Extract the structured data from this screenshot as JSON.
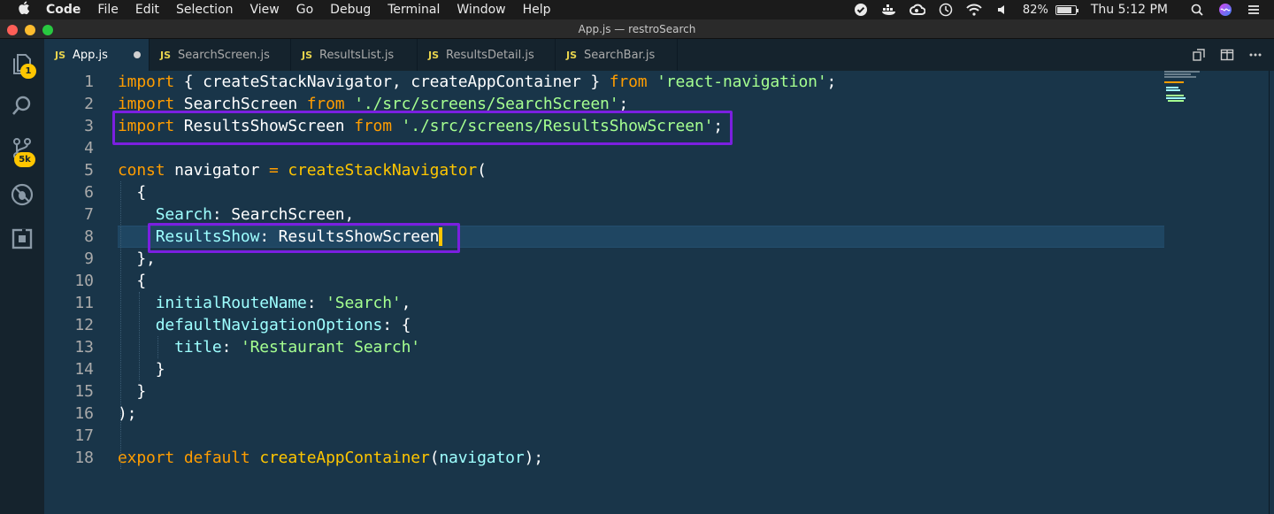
{
  "menubar": {
    "app_name": "Code",
    "items": [
      "File",
      "Edit",
      "Selection",
      "View",
      "Go",
      "Debug",
      "Terminal",
      "Window",
      "Help"
    ],
    "battery_percent": "82%",
    "battery_level": 0.82,
    "clock": "Thu 5:12 PM",
    "status_icons": [
      "checkbox-icon",
      "docker-icon",
      "creative-cloud-icon",
      "time-machine-icon",
      "wifi-icon",
      "volume-icon",
      "spotlight-search-icon",
      "siri-icon",
      "control-center-icon"
    ]
  },
  "window": {
    "title": "App.js — restroSearch"
  },
  "activity_bar": {
    "items": [
      "explorer-icon",
      "search-icon",
      "source-control-icon",
      "debug-icon",
      "extensions-icon"
    ],
    "explorer_badge": "1",
    "source_control_badge": "5k"
  },
  "tabs": [
    {
      "label": "App.js",
      "badge": "JS",
      "active": true,
      "modified": true
    },
    {
      "label": "SearchScreen.js",
      "badge": "JS",
      "active": false
    },
    {
      "label": "ResultsList.js",
      "badge": "JS",
      "active": false
    },
    {
      "label": "ResultsDetail.js",
      "badge": "JS",
      "active": false
    },
    {
      "label": "SearchBar.js",
      "badge": "JS",
      "active": false
    }
  ],
  "editor_actions": [
    "open-changes-icon",
    "split-editor-icon",
    "more-actions-icon"
  ],
  "colors": {
    "background": "#193549",
    "keyword": "#ff9d00",
    "function": "#ffc600",
    "string": "#a5ff90",
    "property": "#9effff",
    "highlight_box": "#7b1fe0",
    "badge": "#ffc600"
  },
  "code": {
    "line_numbers": [
      "1",
      "2",
      "3",
      "4",
      "5",
      "6",
      "7",
      "8",
      "9",
      "10",
      "11",
      "12",
      "13",
      "14",
      "15",
      "16",
      "17",
      "18"
    ],
    "lines": [
      [
        {
          "t": "import",
          "c": "kw"
        },
        {
          "t": " { createStackNavigator, createAppContainer } ",
          "c": "pl"
        },
        {
          "t": "from",
          "c": "kw"
        },
        {
          "t": " ",
          "c": "pl"
        },
        {
          "t": "'react-navigation'",
          "c": "str"
        },
        {
          "t": ";",
          "c": "pl"
        }
      ],
      [
        {
          "t": "import",
          "c": "kw"
        },
        {
          "t": " SearchScreen ",
          "c": "pl"
        },
        {
          "t": "from",
          "c": "kw"
        },
        {
          "t": " ",
          "c": "pl"
        },
        {
          "t": "'./src/screens/SearchScreen'",
          "c": "str"
        },
        {
          "t": ";",
          "c": "pl"
        }
      ],
      [
        {
          "t": "import",
          "c": "kw"
        },
        {
          "t": " ResultsShowScreen ",
          "c": "pl"
        },
        {
          "t": "from",
          "c": "kw"
        },
        {
          "t": " ",
          "c": "pl"
        },
        {
          "t": "'./src/screens/ResultsShowScreen'",
          "c": "str"
        },
        {
          "t": ";",
          "c": "pl"
        }
      ],
      [],
      [
        {
          "t": "const",
          "c": "kw"
        },
        {
          "t": " navigator ",
          "c": "pl"
        },
        {
          "t": "=",
          "c": "kw"
        },
        {
          "t": " ",
          "c": "pl"
        },
        {
          "t": "createStackNavigator",
          "c": "fn"
        },
        {
          "t": "(",
          "c": "pl"
        }
      ],
      [
        {
          "t": "  {",
          "c": "pl"
        }
      ],
      [
        {
          "t": "    ",
          "c": "pl"
        },
        {
          "t": "Search",
          "c": "prop"
        },
        {
          "t": ": SearchScreen,",
          "c": "pl"
        }
      ],
      [
        {
          "t": "    ",
          "c": "pl"
        },
        {
          "t": "ResultsShow",
          "c": "prop"
        },
        {
          "t": ": ResultsShowScreen",
          "c": "pl"
        }
      ],
      [
        {
          "t": "  },",
          "c": "pl"
        }
      ],
      [
        {
          "t": "  {",
          "c": "pl"
        }
      ],
      [
        {
          "t": "    ",
          "c": "pl"
        },
        {
          "t": "initialRouteName",
          "c": "prop"
        },
        {
          "t": ": ",
          "c": "pl"
        },
        {
          "t": "'Search'",
          "c": "str"
        },
        {
          "t": ",",
          "c": "pl"
        }
      ],
      [
        {
          "t": "    ",
          "c": "pl"
        },
        {
          "t": "defaultNavigationOptions",
          "c": "prop"
        },
        {
          "t": ": {",
          "c": "pl"
        }
      ],
      [
        {
          "t": "      ",
          "c": "pl"
        },
        {
          "t": "title",
          "c": "prop"
        },
        {
          "t": ": ",
          "c": "pl"
        },
        {
          "t": "'Restaurant Search'",
          "c": "str"
        }
      ],
      [
        {
          "t": "    }",
          "c": "pl"
        }
      ],
      [
        {
          "t": "  }",
          "c": "pl"
        }
      ],
      [
        {
          "t": ");",
          "c": "pl"
        }
      ],
      [],
      [
        {
          "t": "export",
          "c": "kw"
        },
        {
          "t": " ",
          "c": "pl"
        },
        {
          "t": "default",
          "c": "kw"
        },
        {
          "t": " ",
          "c": "pl"
        },
        {
          "t": "createAppContainer",
          "c": "fn"
        },
        {
          "t": "(",
          "c": "pl"
        },
        {
          "t": "navigator",
          "c": "prop"
        },
        {
          "t": ");",
          "c": "pl"
        }
      ]
    ]
  }
}
